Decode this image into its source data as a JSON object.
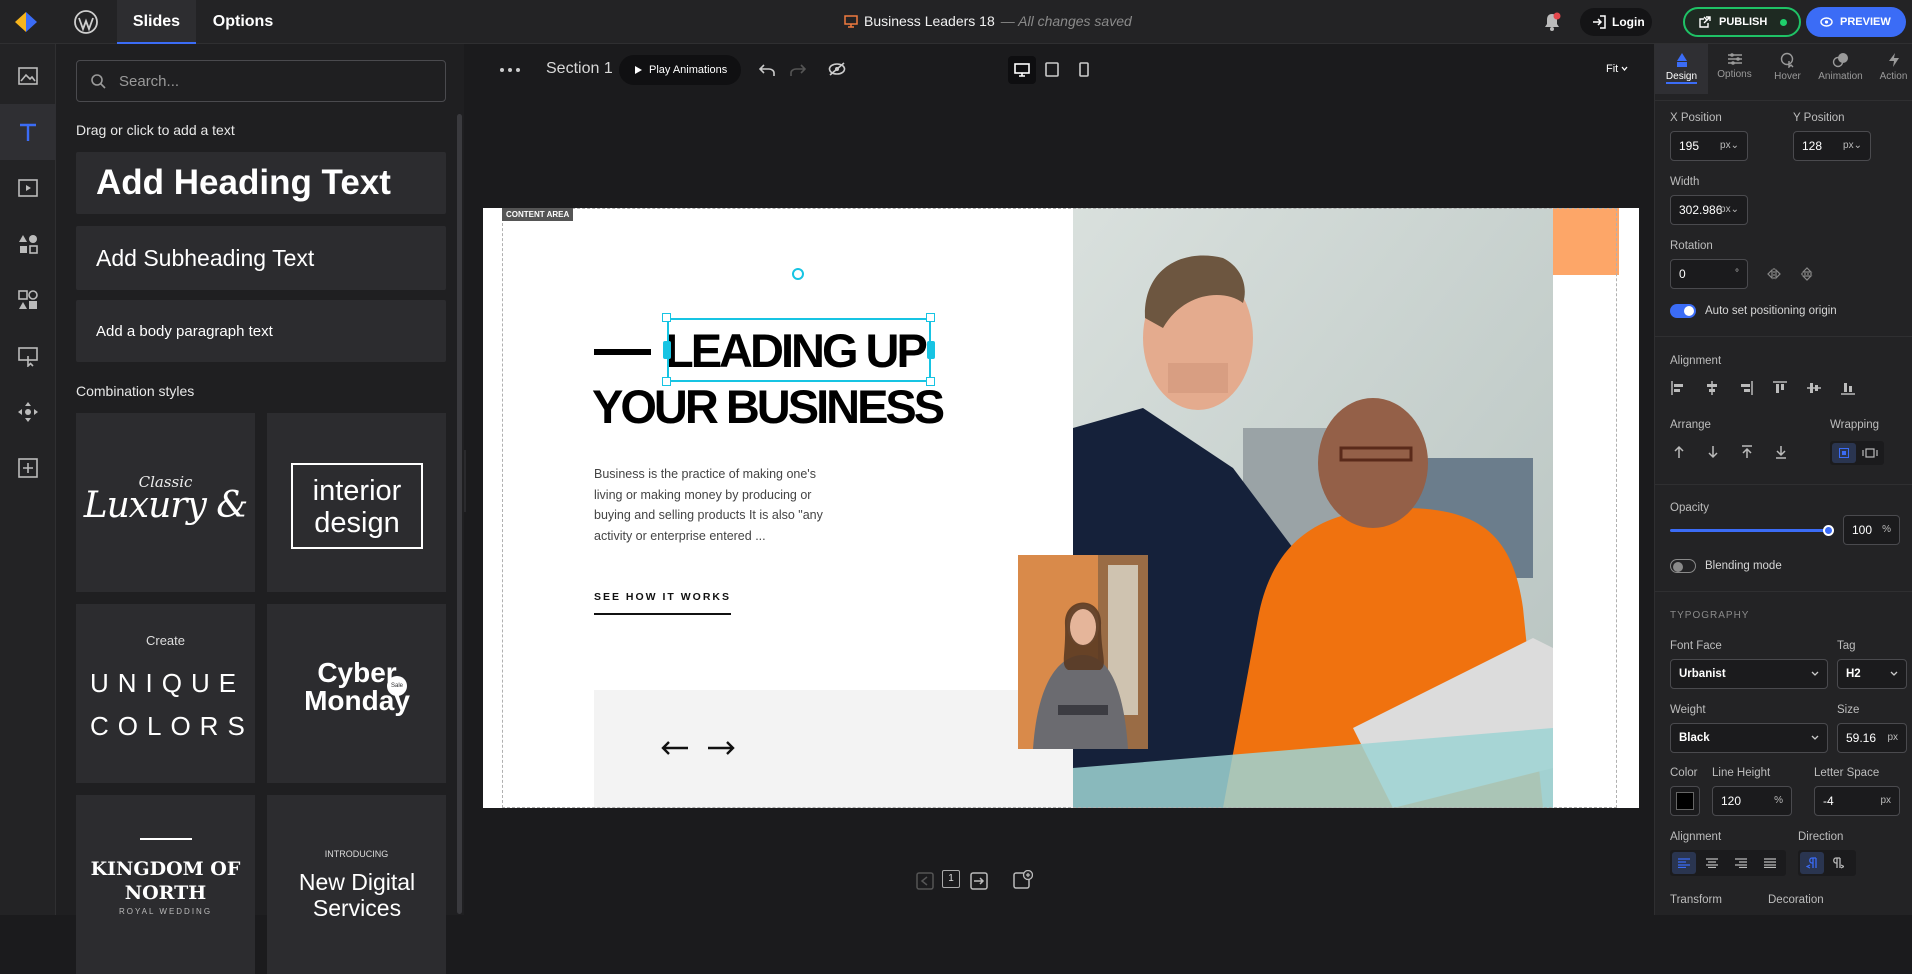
{
  "topbar": {
    "tabs": [
      "Slides",
      "Options"
    ],
    "doc_name": "Business Leaders 18",
    "doc_status": "— All changes saved",
    "login_label": "Login",
    "publish_label": "PUBLISH",
    "preview_label": "PREVIEW"
  },
  "panel": {
    "search_placeholder": "Search...",
    "drag_hint": "Drag or click to add a text",
    "add_heading": "Add Heading Text",
    "add_subheading": "Add Subheading Text",
    "add_body": "Add a body paragraph text",
    "combination_title": "Combination styles",
    "combos": {
      "luxury_small": "Classic",
      "luxury_big": "Luxury &",
      "interior": "interior design",
      "unique_top": "Create",
      "unique_main": "UNIQUE COLORS",
      "cyber": "Cyber Monday",
      "cyber_badge": "Sale",
      "kingdom": "KINGDOM OF NORTH",
      "kingdom_sub": "ROYAL WEDDING",
      "digital_top": "INTRODUCING",
      "digital_main": "New Digital Services"
    }
  },
  "canvas": {
    "section_label": "Section 1",
    "play_label": "Play Animations",
    "fit_label": "Fit",
    "content_area_tag": "CONTENT AREA",
    "heading_line1": "LEADING UP",
    "heading_line2": "YOUR BUSINESS",
    "body_text": "Business is the practice of making one's living or making money by producing or buying and selling products It is also \"any activity or enterprise entered ...",
    "cta_label": "SEE HOW IT WORKS",
    "page_number": "1"
  },
  "props": {
    "tabs": [
      "Design",
      "Options",
      "Hover",
      "Animation",
      "Action"
    ],
    "x_label": "X Position",
    "x_value": "195",
    "y_label": "Y Position",
    "y_value": "128",
    "width_label": "Width",
    "width_value": "302.986",
    "rotation_label": "Rotation",
    "rotation_value": "0",
    "unit_px": "px",
    "unit_deg": "°",
    "unit_pct": "%",
    "auto_origin_label": "Auto set positioning origin",
    "alignment_label": "Alignment",
    "arrange_label": "Arrange",
    "wrapping_label": "Wrapping",
    "opacity_label": "Opacity",
    "opacity_value": "100",
    "blending_label": "Blending mode",
    "typography_label": "TYPOGRAPHY",
    "font_face_label": "Font Face",
    "font_face_value": "Urbanist",
    "tag_label": "Tag",
    "tag_value": "H2",
    "weight_label": "Weight",
    "weight_value": "Black",
    "size_label": "Size",
    "size_value": "59.16",
    "color_label": "Color",
    "color_value": "#000000",
    "line_height_label": "Line Height",
    "line_height_value": "120",
    "letter_space_label": "Letter Space",
    "letter_space_value": "-4",
    "text_alignment_label": "Alignment",
    "direction_label": "Direction",
    "transform_label": "Transform",
    "decoration_label": "Decoration"
  },
  "colors": {
    "accent": "#3b6cf6",
    "publish": "#1fc266",
    "selection": "#17c4e3",
    "orange": "#fda668"
  }
}
